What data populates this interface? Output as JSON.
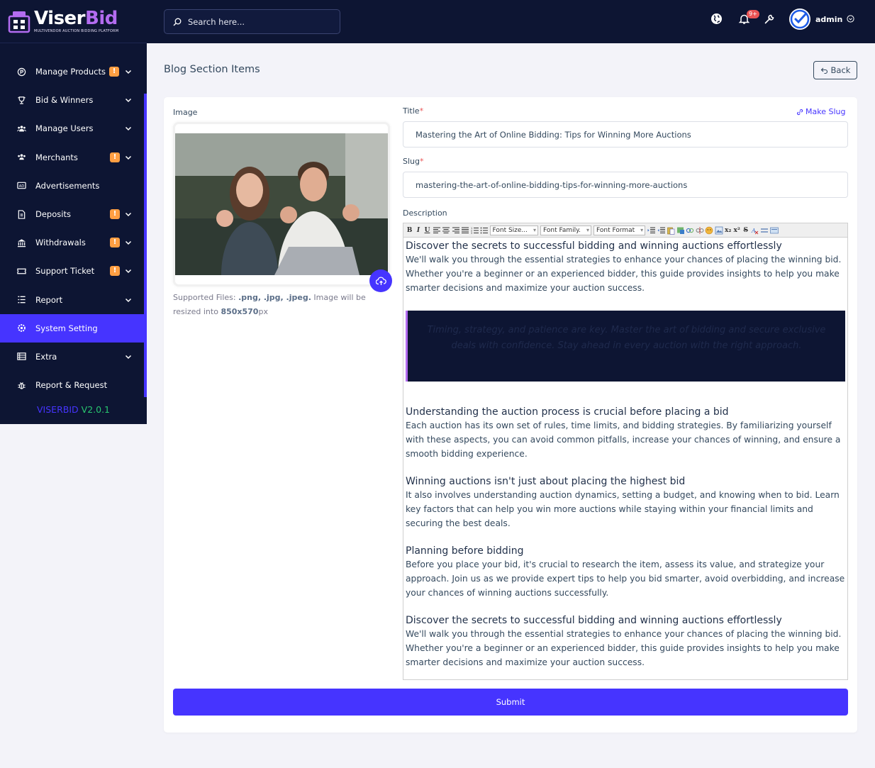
{
  "brand": {
    "name_part1": "Viser",
    "name_part2": "Bid",
    "tagline": "MULTIVENDOR AUCTION BIDDING PLATFORM"
  },
  "sidebar": {
    "items": [
      {
        "label": "Manage Products",
        "badge": "!",
        "has_chevron": true,
        "icon": "product-icon"
      },
      {
        "label": "Bid & Winners",
        "badge": "",
        "has_chevron": true,
        "icon": "trophy-icon"
      },
      {
        "label": "Manage Users",
        "badge": "",
        "has_chevron": true,
        "icon": "users-icon"
      },
      {
        "label": "Merchants",
        "badge": "!",
        "has_chevron": true,
        "icon": "merchants-icon"
      },
      {
        "label": "Advertisements",
        "badge": "",
        "has_chevron": false,
        "icon": "ad-icon"
      },
      {
        "label": "Deposits",
        "badge": "!",
        "has_chevron": true,
        "icon": "deposit-icon"
      },
      {
        "label": "Withdrawals",
        "badge": "!",
        "has_chevron": true,
        "icon": "bank-icon"
      },
      {
        "label": "Support Ticket",
        "badge": "!",
        "has_chevron": true,
        "icon": "ticket-icon"
      },
      {
        "label": "Report",
        "badge": "",
        "has_chevron": true,
        "icon": "report-icon"
      },
      {
        "label": "System Setting",
        "badge": "",
        "has_chevron": false,
        "icon": "settings-icon",
        "active": true
      },
      {
        "label": "Extra",
        "badge": "",
        "has_chevron": true,
        "icon": "server-icon"
      },
      {
        "label": "Report & Request",
        "badge": "",
        "has_chevron": false,
        "icon": "bug-icon"
      }
    ],
    "version_label": "VISERBID",
    "version_number": "V2.0.1"
  },
  "topbar": {
    "search_placeholder": "Search here...",
    "notification_badge": "9+",
    "user_name": "admin"
  },
  "page": {
    "title": "Blog Section Items",
    "back_label": "Back"
  },
  "form": {
    "image_label": "Image",
    "supported_prefix": "Supported Files: ",
    "supported_types": ".png, .jpg, .jpeg.",
    "resize_text": " Image will be resized into ",
    "resize_size": "850x570",
    "resize_unit": "px",
    "title_label": "Title",
    "make_slug_label": "Make Slug",
    "title_value": "Mastering the Art of Online Bidding: Tips for Winning More Auctions",
    "slug_label": "Slug",
    "slug_value": "mastering-the-art-of-online-bidding-tips-for-winning-more-auctions",
    "description_label": "Description",
    "toolbar": {
      "font_size": "Font Size...",
      "font_family": "Font Family.",
      "font_format": "Font Format"
    },
    "description": {
      "h1": "Discover the secrets to successful bidding and winning auctions effortlessly",
      "p1": "We'll walk you through the essential strategies to enhance your chances of placing the winning bid. Whether you're a beginner or an experienced bidder, this guide provides insights to help you make smarter decisions and maximize your auction success.",
      "quote": "Timing, strategy, and patience are key. Master the art of bidding and secure exclusive deals with confidence. Stay ahead in every auction with the right approach.",
      "h2": "Understanding the auction process is crucial before placing a bid",
      "p2": "Each auction has its own set of rules, time limits, and bidding strategies. By familiarizing yourself with these aspects, you can avoid common pitfalls, increase your chances of winning, and ensure a smooth bidding experience.",
      "h3": "Winning auctions isn't just about placing the highest bid",
      "p3": "It also involves understanding auction dynamics, setting a budget, and knowing when to bid. Learn key factors that can help you win more auctions while staying within your financial limits and securing the best deals.",
      "h4": "Planning before bidding",
      "p4": "Before you place your bid, it's crucial to research the item, assess its value, and strategize your approach. Join us as we provide expert tips to help you bid smarter, avoid overbidding, and increase your chances of winning auctions successfully.",
      "h5": "Discover the secrets to successful bidding and winning auctions effortlessly",
      "p5": "We'll walk you through the essential strategies to enhance your chances of placing the winning bid. Whether you're a beginner or an experienced bidder, this guide provides insights to help you make smarter decisions and maximize your auction success."
    },
    "submit_label": "Submit"
  },
  "colors": {
    "primary": "#4634ff",
    "sidebar_bg": "#0d1533",
    "warning": "#ff9f43",
    "danger": "#ea5455",
    "brand_accent": "#b36cf0"
  }
}
